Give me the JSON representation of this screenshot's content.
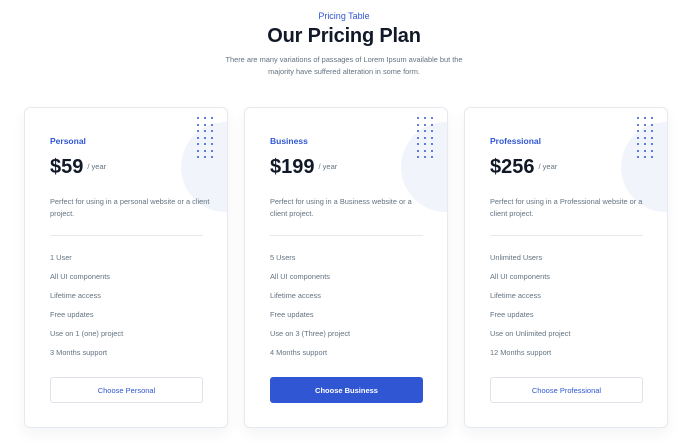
{
  "header": {
    "eyebrow": "Pricing Table",
    "title": "Our Pricing Plan",
    "subtitle": "There are many variations of passages of Lorem Ipsum available but the majority have suffered alteration in some form."
  },
  "plans": [
    {
      "name": "Personal",
      "price": "$59",
      "period": "/ year",
      "description": "Perfect for using in a personal website or a client project.",
      "features": [
        "1 User",
        "All UI components",
        "Lifetime access",
        "Free updates",
        "Use on 1 (one) project",
        "3 Months support"
      ],
      "button": "Choose Personal"
    },
    {
      "name": "Business",
      "price": "$199",
      "period": "/ year",
      "description": "Perfect for using in a Business website or a client project.",
      "features": [
        "5 Users",
        "All UI components",
        "Lifetime access",
        "Free updates",
        "Use on 3 (Three) project",
        "4 Months support"
      ],
      "button": "Choose Business"
    },
    {
      "name": "Professional",
      "price": "$256",
      "period": "/ year",
      "description": "Perfect for using in a Professional website or a client project.",
      "features": [
        "Unlimited Users",
        "All UI components",
        "Lifetime access",
        "Free updates",
        "Use on Unlimited project",
        "12 Months support"
      ],
      "button": "Choose Professional"
    }
  ],
  "colors": {
    "accent": "#3056d3",
    "heading": "#111928",
    "body_text": "#637381",
    "border": "#e7e9ef"
  }
}
